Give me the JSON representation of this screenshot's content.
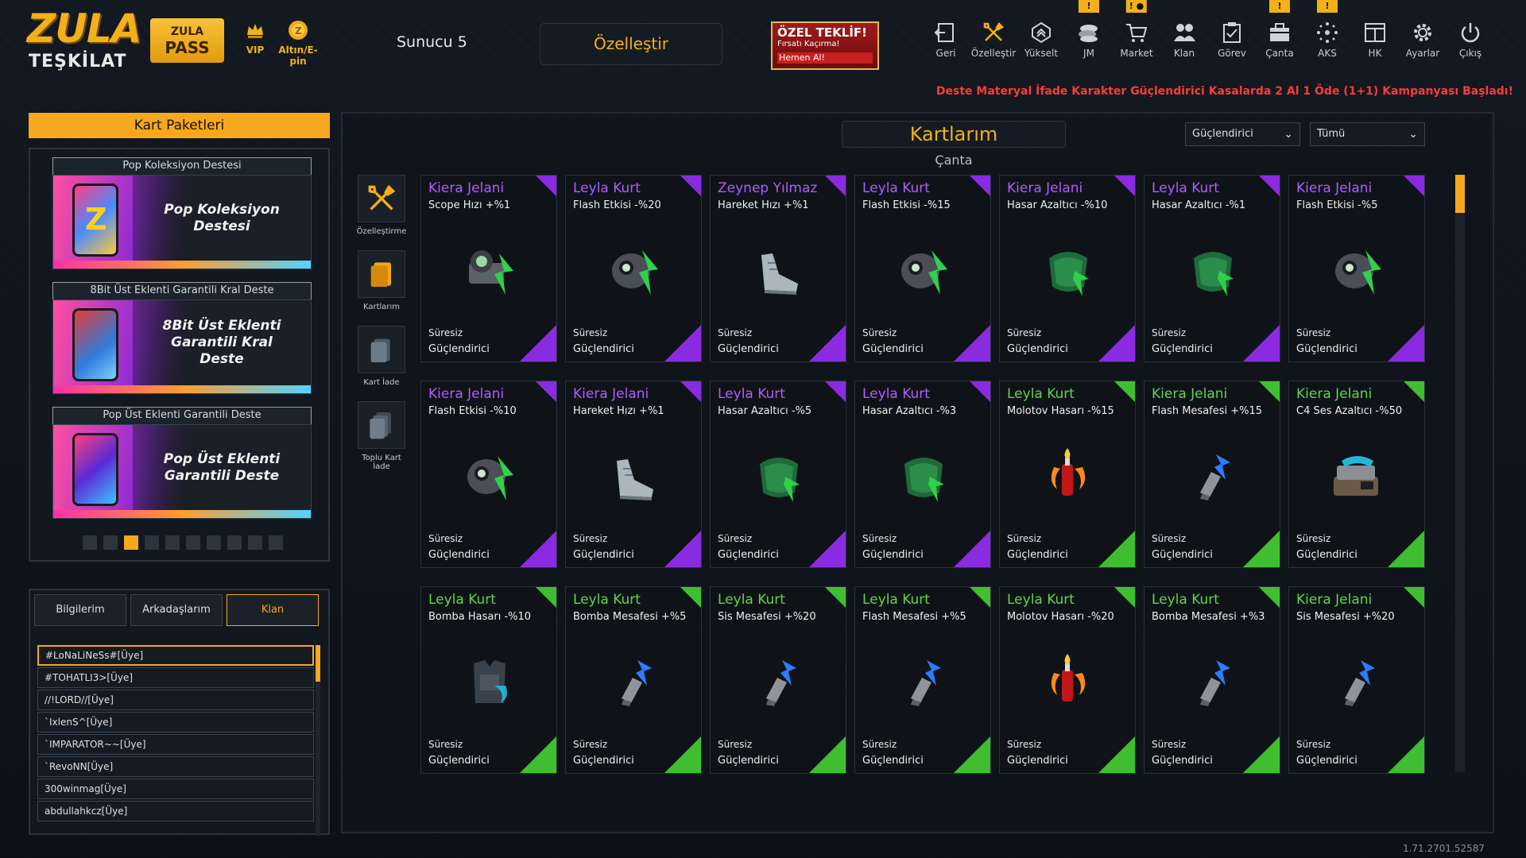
{
  "logo": {
    "line1": "ZULA",
    "line2": "TEŞKİLAT"
  },
  "zula_pass": {
    "line1": "ZULA",
    "line2": "PASS"
  },
  "vip_label": "VIP",
  "altin_label": "Altın/E-pin",
  "server_label": "Sunucu 5",
  "customize_button": "Özelleştir",
  "offer": {
    "title": "ÖZEL TEKLİF!",
    "subtitle": "Fırsatı Kaçırma!",
    "cta": "Hemen Al!"
  },
  "nav": [
    {
      "label": "Geri",
      "icon": "back-icon",
      "badge": ""
    },
    {
      "label": "Özelleştir",
      "icon": "tools-icon",
      "badge": ""
    },
    {
      "label": "Yükselt",
      "icon": "upgrade-icon",
      "badge": ""
    },
    {
      "label": "JM",
      "icon": "coins-icon",
      "badge": "!"
    },
    {
      "label": "Market",
      "icon": "cart-icon",
      "badge": "! ●"
    },
    {
      "label": "Klan",
      "icon": "clan-icon",
      "badge": ""
    },
    {
      "label": "Görev",
      "icon": "clipboard-icon",
      "badge": ""
    },
    {
      "label": "Çanta",
      "icon": "bag-icon",
      "badge": "!"
    },
    {
      "label": "AKS",
      "icon": "aks-icon",
      "badge": "!"
    },
    {
      "label": "HK",
      "icon": "hk-icon",
      "badge": ""
    },
    {
      "label": "Ayarlar",
      "icon": "gear-icon",
      "badge": ""
    },
    {
      "label": "Çıkış",
      "icon": "power-icon",
      "badge": ""
    }
  ],
  "announcement": "Deste Materyal İfade Karakter Güçlendirici Kasalarda 2 Al 1 Öde (1+1) Kampanyası Başladı!",
  "card_packs": {
    "title": "Kart Paketleri",
    "packs": [
      {
        "title": "Pop Koleksiyon Destesi",
        "name_line1": "Pop Koleksiyon",
        "name_line2": "Destesi",
        "name_line3": ""
      },
      {
        "title": "8Bit Üst Eklenti Garantili Kral Deste",
        "name_line1": "8Bit Üst Eklenti",
        "name_line2": "Garantili Kral",
        "name_line3": "Deste"
      },
      {
        "title": "Pop Üst Eklenti Garantili Deste",
        "name_line1": "Pop Üst Eklenti",
        "name_line2": "Garantili Deste",
        "name_line3": ""
      }
    ],
    "page_count": 10,
    "active_page": 3
  },
  "social": {
    "tabs": [
      "Bilgilerim",
      "Arkadaşlarım",
      "Klan"
    ],
    "active_tab": "Klan",
    "members": [
      "#LoNaLiNeSs#[Üye]",
      "#TOHATLI3>[Üye]",
      "//!LORD//[Üye]",
      "`IxlenS^[Üye]",
      "`IMPARATOR~~[Üye]",
      "`RevoNN[Üye]",
      "300winmag[Üye]",
      "abdullahkcz[Üye]"
    ]
  },
  "main": {
    "title": "Kartlarım",
    "subtitle": "Çanta",
    "filter1": "Güçlendirici",
    "filter2": "Tümü"
  },
  "side_tools": [
    {
      "label": "Özelleştirme",
      "icon": "tools-icon"
    },
    {
      "label": "Kartlarım",
      "icon": "cards-icon"
    },
    {
      "label": "Kart İade",
      "icon": "card-return-icon"
    },
    {
      "label": "Toplu Kart İade",
      "icon": "bulk-card-return-icon"
    }
  ],
  "colors": {
    "accent": "#f7a81c",
    "purple": "#8a2be2",
    "green": "#3fbf2f",
    "name_purple": "#b05cff",
    "name_green": "#5ed64a",
    "alert_red": "#ff3b3b"
  },
  "cards": [
    {
      "name": "Kiera Jelani",
      "stat": "Scope Hızı +%1",
      "duration": "Süresiz",
      "type": "Güçlendirici",
      "rarity": "purple",
      "art": "scope"
    },
    {
      "name": "Leyla Kurt",
      "stat": "Flash Etkisi -%20",
      "duration": "Süresiz",
      "type": "Güçlendirici",
      "rarity": "purple",
      "art": "flash"
    },
    {
      "name": "Zeynep Yılmaz",
      "stat": "Hareket Hızı +%1",
      "duration": "Süresiz",
      "type": "Güçlendirici",
      "rarity": "purple",
      "art": "shoe"
    },
    {
      "name": "Leyla Kurt",
      "stat": "Flash Etkisi -%15",
      "duration": "Süresiz",
      "type": "Güçlendirici",
      "rarity": "purple",
      "art": "flash"
    },
    {
      "name": "Kiera Jelani",
      "stat": "Hasar Azaltıcı -%10",
      "duration": "Süresiz",
      "type": "Güçlendirici",
      "rarity": "purple",
      "art": "armor"
    },
    {
      "name": "Leyla Kurt",
      "stat": "Hasar Azaltıcı -%1",
      "duration": "Süresiz",
      "type": "Güçlendirici",
      "rarity": "purple",
      "art": "armor"
    },
    {
      "name": "Kiera Jelani",
      "stat": "Flash Etkisi -%5",
      "duration": "Süresiz",
      "type": "Güçlendirici",
      "rarity": "purple",
      "art": "flash"
    },
    {
      "name": "Kiera Jelani",
      "stat": "Flash Etkisi -%10",
      "duration": "Süresiz",
      "type": "Güçlendirici",
      "rarity": "purple",
      "art": "flash"
    },
    {
      "name": "Kiera Jelani",
      "stat": "Hareket Hızı +%1",
      "duration": "Süresiz",
      "type": "Güçlendirici",
      "rarity": "purple",
      "art": "shoe"
    },
    {
      "name": "Leyla Kurt",
      "stat": "Hasar Azaltıcı -%5",
      "duration": "Süresiz",
      "type": "Güçlendirici",
      "rarity": "purple",
      "art": "armor"
    },
    {
      "name": "Leyla Kurt",
      "stat": "Hasar Azaltıcı -%3",
      "duration": "Süresiz",
      "type": "Güçlendirici",
      "rarity": "purple",
      "art": "armor"
    },
    {
      "name": "Leyla Kurt",
      "stat": "Molotov Hasarı -%15",
      "duration": "Süresiz",
      "type": "Güçlendirici",
      "rarity": "green",
      "art": "molotov"
    },
    {
      "name": "Kiera Jelani",
      "stat": "Flash Mesafesi +%15",
      "duration": "Süresiz",
      "type": "Güçlendirici",
      "rarity": "green",
      "art": "grenade"
    },
    {
      "name": "Kiera Jelani",
      "stat": "C4 Ses Azaltıcı -%50",
      "duration": "Süresiz",
      "type": "Güçlendirici",
      "rarity": "green",
      "art": "c4"
    },
    {
      "name": "Leyla Kurt",
      "stat": "Bomba Hasarı -%10",
      "duration": "Süresiz",
      "type": "Güçlendirici",
      "rarity": "green",
      "art": "vest"
    },
    {
      "name": "Leyla Kurt",
      "stat": "Bomba Mesafesi +%5",
      "duration": "Süresiz",
      "type": "Güçlendirici",
      "rarity": "green",
      "art": "grenade"
    },
    {
      "name": "Leyla Kurt",
      "stat": "Sis Mesafesi +%20",
      "duration": "Süresiz",
      "type": "Güçlendirici",
      "rarity": "green",
      "art": "grenade"
    },
    {
      "name": "Leyla Kurt",
      "stat": "Flash Mesafesi +%5",
      "duration": "Süresiz",
      "type": "Güçlendirici",
      "rarity": "green",
      "art": "grenade"
    },
    {
      "name": "Leyla Kurt",
      "stat": "Molotov Hasarı -%20",
      "duration": "Süresiz",
      "type": "Güçlendirici",
      "rarity": "green",
      "art": "molotov"
    },
    {
      "name": "Leyla Kurt",
      "stat": "Bomba Mesafesi +%3",
      "duration": "Süresiz",
      "type": "Güçlendirici",
      "rarity": "green",
      "art": "grenade"
    },
    {
      "name": "Kiera Jelani",
      "stat": "Sis Mesafesi +%20",
      "duration": "Süresiz",
      "type": "Güçlendirici",
      "rarity": "green",
      "art": "grenade"
    }
  ],
  "version": "1.71.2701.52587"
}
